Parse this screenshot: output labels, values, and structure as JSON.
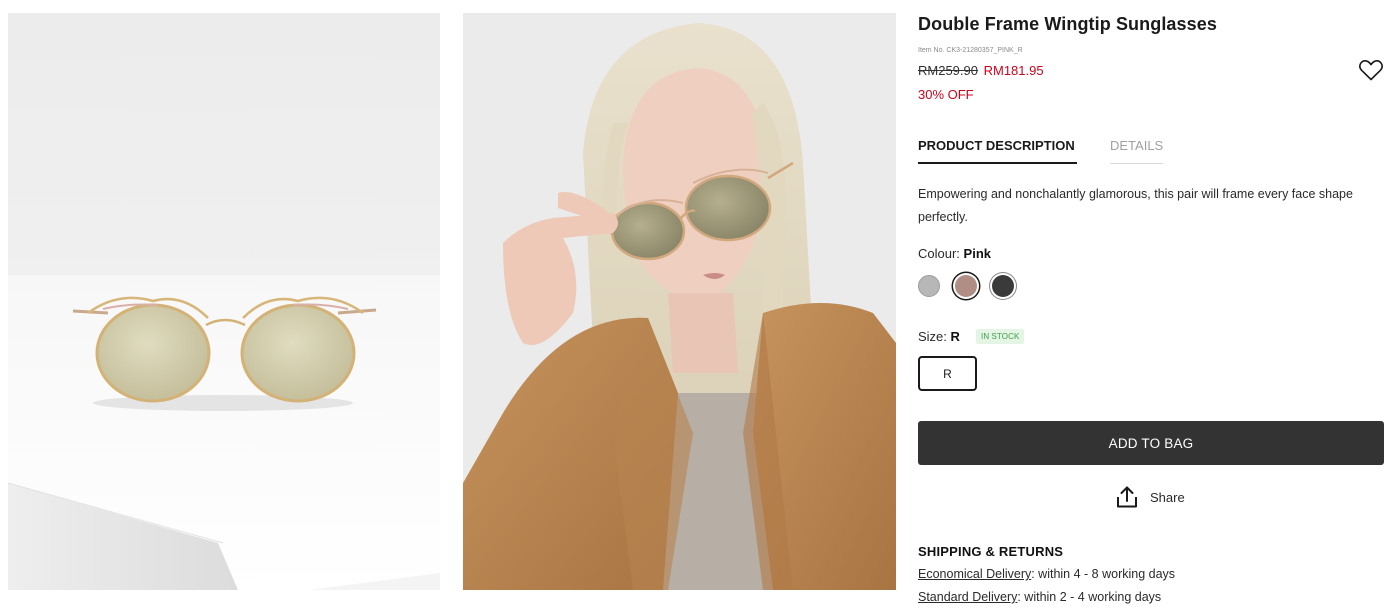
{
  "product": {
    "title": "Double Frame Wingtip Sunglasses",
    "item_no": "Item No. CK3-21280357_PINK_R",
    "price_original": "RM259.90",
    "price_sale": "RM181.95",
    "discount": "30% OFF"
  },
  "tabs": [
    {
      "label": "PRODUCT DESCRIPTION",
      "active": true
    },
    {
      "label": "DETAILS",
      "active": false
    }
  ],
  "description": "Empowering and nonchalantly glamorous, this pair will frame every face shape perfectly.",
  "colour": {
    "label": "Colour:",
    "selected": "Pink",
    "swatches": [
      {
        "name": "silver",
        "hex": "#b7b7b7"
      },
      {
        "name": "pink",
        "hex": "#b08d85"
      },
      {
        "name": "black",
        "hex": "#3a3a3a"
      }
    ]
  },
  "size": {
    "label": "Size:",
    "selected": "R",
    "stock_badge": "IN STOCK",
    "options": [
      "R"
    ]
  },
  "actions": {
    "add_to_bag": "ADD TO BAG",
    "share": "Share"
  },
  "shipping": {
    "title": "SHIPPING & RETURNS",
    "lines": [
      {
        "link": "Economical Delivery",
        "text": ": within 4 - 8 working days"
      },
      {
        "link": "Standard Delivery",
        "text": ": within 2 - 4 working days"
      }
    ]
  },
  "icons": [
    "heart-icon",
    "share-icon"
  ],
  "colors": {
    "sale_red": "#d0021b",
    "button_dark": "#333333",
    "stock_green": "#3e9d48"
  }
}
